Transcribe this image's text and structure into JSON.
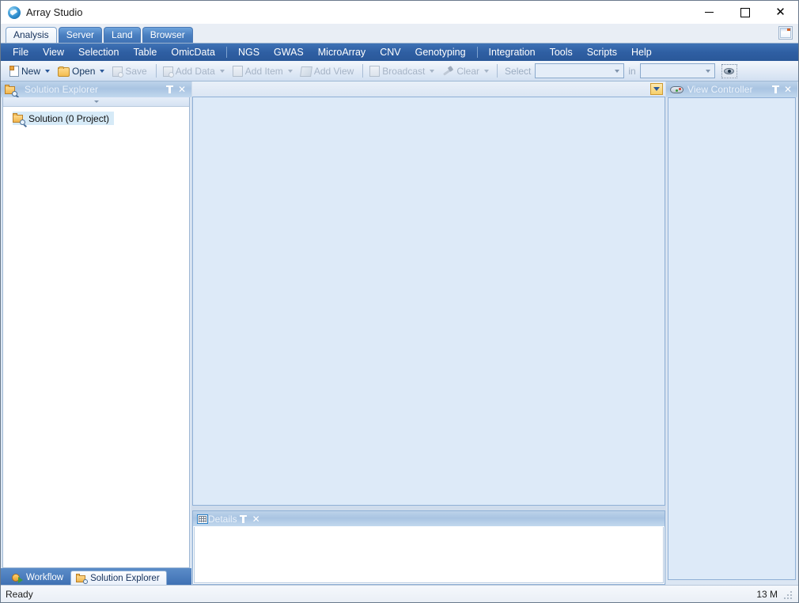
{
  "window": {
    "title": "Array Studio",
    "app_icon": "array-studio-logo-icon",
    "minimize_label": "—",
    "maximize_label": "□",
    "close_label": "✕"
  },
  "ribbon_tabs": [
    {
      "label": "Analysis",
      "active": true
    },
    {
      "label": "Server",
      "active": false
    },
    {
      "label": "Land",
      "active": false
    },
    {
      "label": "Browser",
      "active": false
    }
  ],
  "menubar": [
    {
      "label": "File",
      "type": "item"
    },
    {
      "label": "View",
      "type": "item"
    },
    {
      "label": "Selection",
      "type": "item"
    },
    {
      "label": "Table",
      "type": "item"
    },
    {
      "label": "OmicData",
      "type": "item"
    },
    {
      "label": "",
      "type": "separator"
    },
    {
      "label": "NGS",
      "type": "item"
    },
    {
      "label": "GWAS",
      "type": "item"
    },
    {
      "label": "MicroArray",
      "type": "item"
    },
    {
      "label": "CNV",
      "type": "item"
    },
    {
      "label": "Genotyping",
      "type": "item"
    },
    {
      "label": "",
      "type": "separator"
    },
    {
      "label": "Integration",
      "type": "item"
    },
    {
      "label": "Tools",
      "type": "item"
    },
    {
      "label": "Scripts",
      "type": "item"
    },
    {
      "label": "Help",
      "type": "item"
    }
  ],
  "toolbar": {
    "new_label": "New",
    "open_label": "Open",
    "save_label": "Save",
    "add_data_label": "Add Data",
    "add_item_label": "Add Item",
    "add_view_label": "Add View",
    "broadcast_label": "Broadcast",
    "clear_label": "Clear",
    "select_label": "Select",
    "in_label": "in",
    "select_combo_value": "",
    "in_combo_value": "",
    "eye_button_name": "eye-icon"
  },
  "solution_explorer": {
    "title": "Solution Explorer",
    "pin_label": "pin-icon",
    "close_label": "✕",
    "tree": [
      {
        "label": "Solution (0 Project)",
        "icon": "solution-folder-icon",
        "selected": true
      }
    ]
  },
  "dock_tabs": [
    {
      "label": "Workflow",
      "icon": "workflow-icon",
      "active": false
    },
    {
      "label": "Solution Explorer",
      "icon": "solution-explorer-icon",
      "active": true
    }
  ],
  "document_area": {
    "dropdown_name": "document-list-dropdown",
    "content": ""
  },
  "details_panel": {
    "title": "Details",
    "icon": "table-grid-icon",
    "pin_label": "pin-icon",
    "close_label": "✕",
    "content": ""
  },
  "view_controller": {
    "title": "View Controller",
    "icon": "game-controller-icon",
    "pin_label": "pin-icon",
    "close_label": "✕",
    "content": ""
  },
  "statusbar": {
    "status_text": "Ready",
    "memory_text": "13 M"
  },
  "colors": {
    "menu_blue": "#2f5fa3",
    "tab_blue": "#4a7fc0",
    "panel_header": "#a9c4e2",
    "canvas": "#ddeaf8",
    "accent_orange": "#f6cf6a",
    "selection": "#d6eaf7"
  }
}
